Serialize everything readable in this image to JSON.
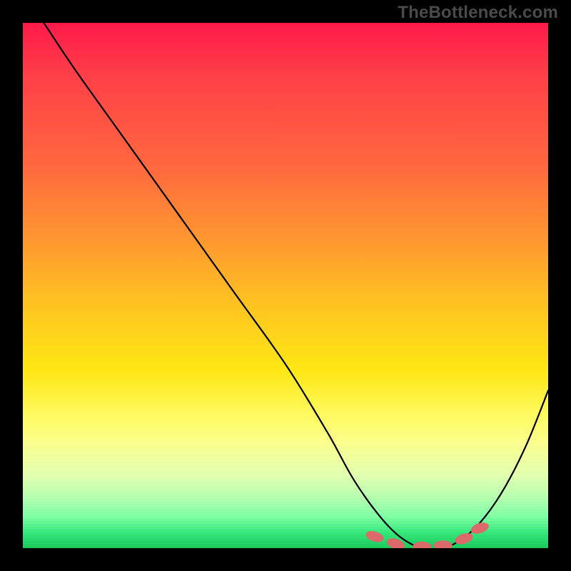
{
  "watermark": "TheBottleneck.com",
  "colors": {
    "background": "#000000",
    "curve": "#000000",
    "blob": "#db6b6b",
    "gradient_stops": [
      "#ff1a4b",
      "#ff3f48",
      "#ff6a3e",
      "#ff9a2f",
      "#ffc81f",
      "#ffe714",
      "#fff95a",
      "#fbff8e",
      "#e3ffae",
      "#b9ffb0",
      "#7effa4",
      "#35e87a",
      "#19c95a"
    ]
  },
  "chart_data": {
    "type": "line",
    "title": "",
    "xlabel": "",
    "ylabel": "",
    "xlim": [
      0,
      100
    ],
    "ylim": [
      0,
      100
    ],
    "series": [
      {
        "name": "bottleneck-curve",
        "x": [
          4,
          10,
          20,
          30,
          40,
          50,
          58,
          63,
          68,
          72,
          76,
          80,
          84,
          88,
          92,
          96,
          100
        ],
        "y": [
          100,
          91,
          77,
          63,
          49,
          35,
          22,
          13,
          6,
          2,
          0,
          0,
          2,
          6,
          12,
          20,
          30
        ]
      }
    ],
    "markers": [
      {
        "x": 67,
        "y": 2.2
      },
      {
        "x": 71,
        "y": 0.8
      },
      {
        "x": 76,
        "y": 0.3
      },
      {
        "x": 80,
        "y": 0.5
      },
      {
        "x": 84,
        "y": 1.8
      },
      {
        "x": 87,
        "y": 3.8
      }
    ],
    "note": "x and y are in percent of plot-area width/height; y=0 is the bottom edge (minimum of the curve), y=100 is the top edge. The curve descends steeply from top-left, reaches a flat minimum around x≈74–80, then rises toward the right edge."
  }
}
